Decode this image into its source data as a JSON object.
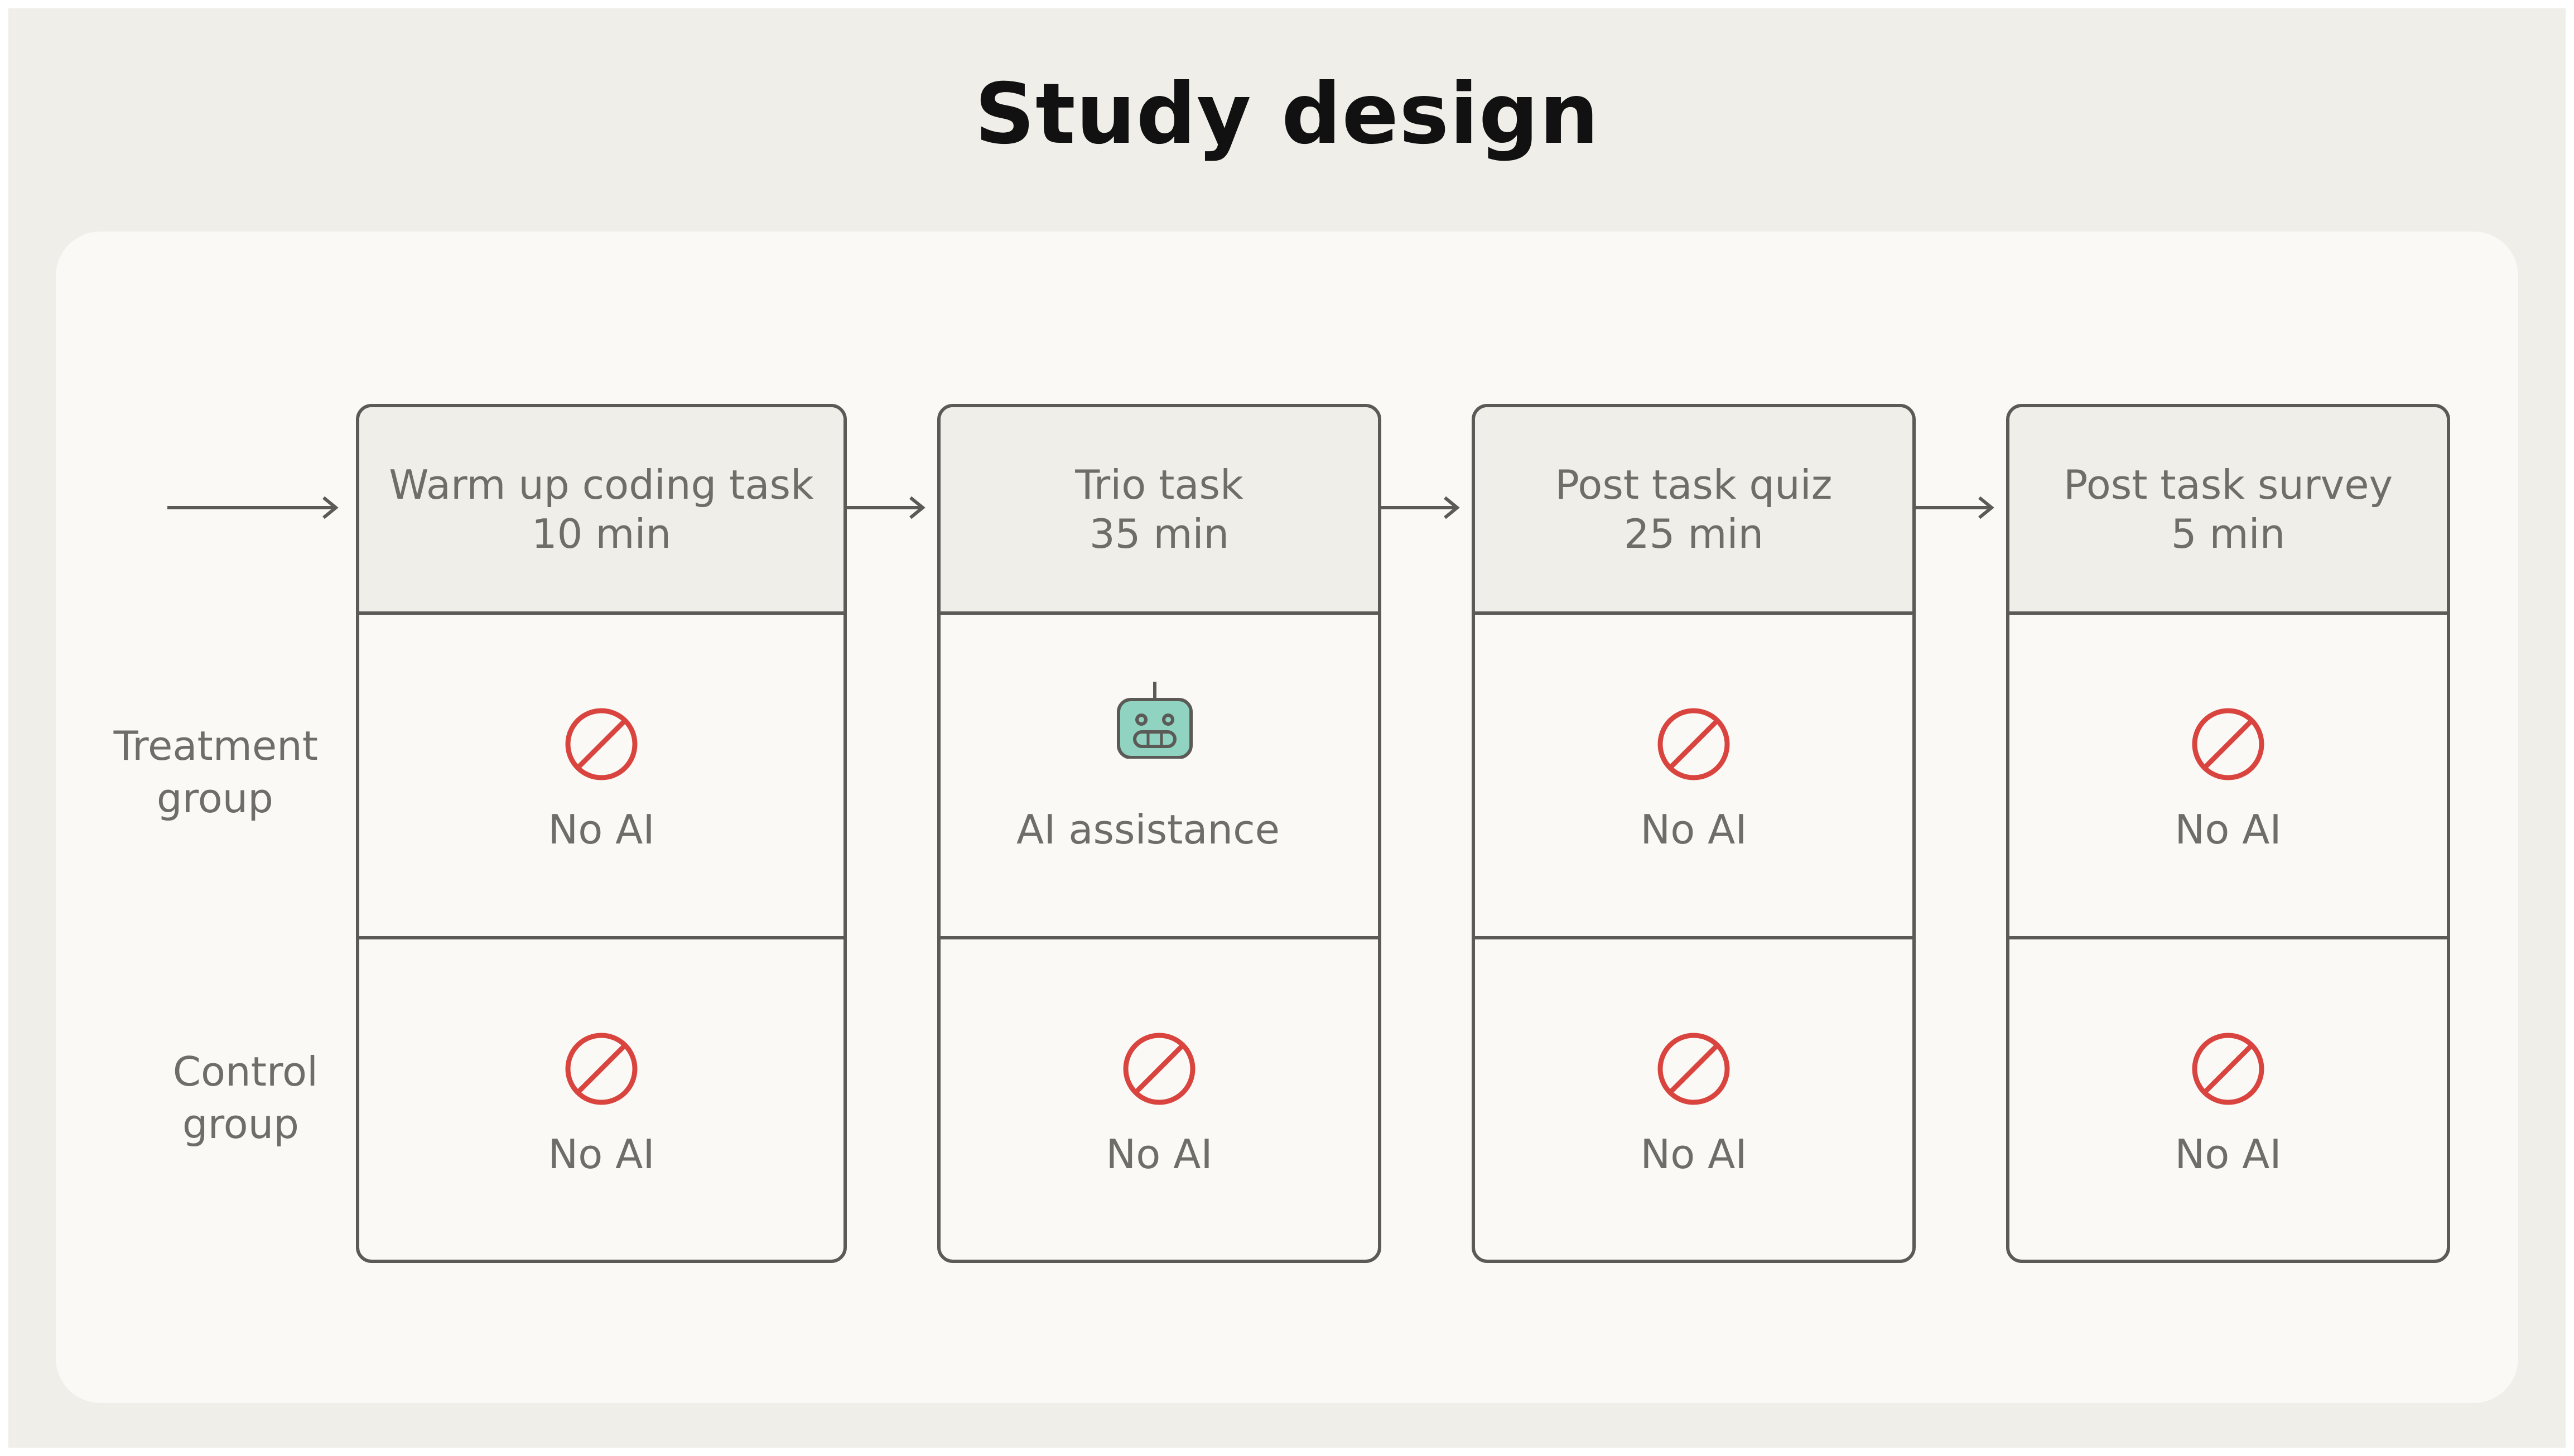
{
  "title": "Study design",
  "rows": {
    "treatment": {
      "line1": "Treatment",
      "line2": "group"
    },
    "control": {
      "line1": "Control",
      "line2": "group"
    }
  },
  "stages": [
    {
      "name": "Warm up coding task",
      "duration": "10 min",
      "treatment": "No AI",
      "treatment_icon": "no-ai-icon",
      "control": "No AI",
      "control_icon": "no-ai-icon"
    },
    {
      "name": "Trio task",
      "duration": "35 min",
      "treatment": "AI assistance",
      "treatment_icon": "robot-icon",
      "control": "No AI",
      "control_icon": "no-ai-icon"
    },
    {
      "name": "Post task quiz",
      "duration": "25 min",
      "treatment": "No AI",
      "treatment_icon": "no-ai-icon",
      "control": "No AI",
      "control_icon": "no-ai-icon"
    },
    {
      "name": "Post task survey",
      "duration": "5 min",
      "treatment": "No AI",
      "treatment_icon": "no-ai-icon",
      "control": "No AI",
      "control_icon": "no-ai-icon"
    }
  ],
  "colors": {
    "background": "#f0eee9",
    "panel": "#faf9f6",
    "border": "#5b5a56",
    "text": "#6f6d68",
    "no_ai_red": "#d9443f",
    "robot_fill": "#8fd3c0"
  }
}
